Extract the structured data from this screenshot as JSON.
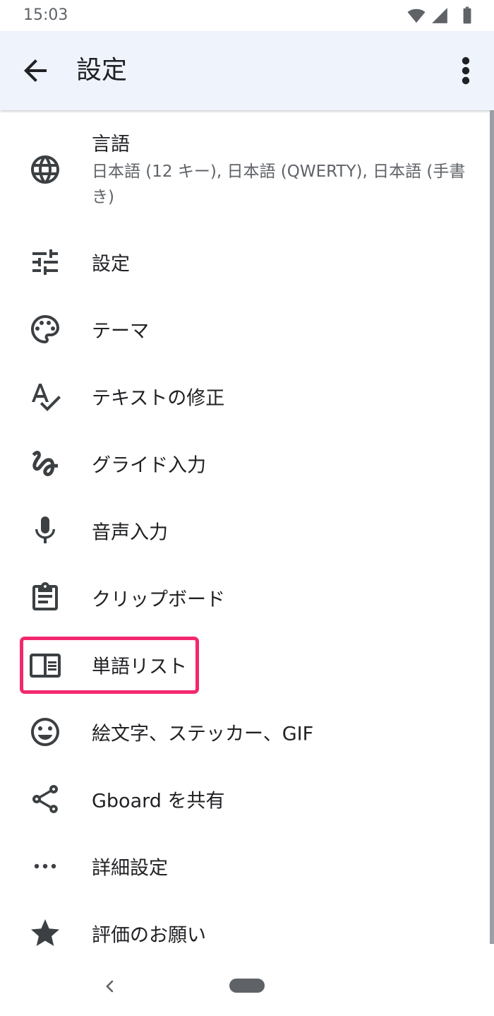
{
  "status_bar": {
    "time": "15:03",
    "icons": [
      "wifi-icon",
      "cellular-signal-icon",
      "battery-icon"
    ]
  },
  "app_bar": {
    "title": "設定",
    "back_icon": "arrow-back-icon",
    "more_icon": "more-vert-icon"
  },
  "settings": {
    "items": [
      {
        "icon": "globe-icon",
        "title": "言語",
        "summary": "日本語 (12 キー), 日本語 (QWERTY), 日本語 (手書き)"
      },
      {
        "icon": "tune-icon",
        "title": "設定"
      },
      {
        "icon": "palette-icon",
        "title": "テーマ"
      },
      {
        "icon": "spellcheck-icon",
        "title": "テキストの修正"
      },
      {
        "icon": "gesture-icon",
        "title": "グライド入力"
      },
      {
        "icon": "mic-icon",
        "title": "音声入力"
      },
      {
        "icon": "clipboard-icon",
        "title": "クリップボード"
      },
      {
        "icon": "chrome-reader-icon",
        "title": "単語リスト",
        "highlighted": true
      },
      {
        "icon": "smiley-icon",
        "title": "絵文字、ステッカー、GIF"
      },
      {
        "icon": "share-icon",
        "title": "Gboard を共有"
      },
      {
        "icon": "more-horiz-icon",
        "title": "詳細設定"
      },
      {
        "icon": "star-icon",
        "title": "評価のお願い"
      }
    ]
  },
  "colors": {
    "app_bar_bg": "#eef3fc",
    "highlight": "#f2286f",
    "icon": "#3c4043",
    "text_primary": "#202124",
    "text_secondary": "#5f6368"
  },
  "nav_bar": {
    "back_icon": "nav-back-chevron-icon",
    "home_icon": "home-pill-icon"
  }
}
